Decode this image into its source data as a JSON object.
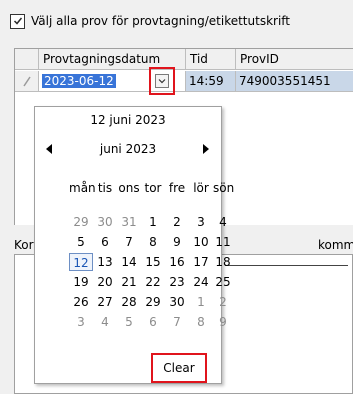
{
  "select_all": {
    "label": "Välj alla prov för provtagning/etikettutskrift",
    "checked": true
  },
  "grid": {
    "columns": [
      "Provtagningsdatum",
      "Tid",
      "ProvID"
    ],
    "row": {
      "date": "2023-06-12",
      "time": "14:59",
      "prov_id": "749003551451"
    }
  },
  "lower": {
    "left_label": "Kor",
    "right_label": "komm"
  },
  "calendar": {
    "today_text": "12 juni 2023",
    "month_text": "juni 2023",
    "weekdays": [
      "mån",
      "tis",
      "ons",
      "tor",
      "fre",
      "lör",
      "sön"
    ],
    "weeks": [
      [
        "29",
        "30",
        "31",
        "1",
        "2",
        "3",
        "4"
      ],
      [
        "5",
        "6",
        "7",
        "8",
        "9",
        "10",
        "11"
      ],
      [
        "12",
        "13",
        "14",
        "15",
        "16",
        "17",
        "18"
      ],
      [
        "19",
        "20",
        "21",
        "22",
        "23",
        "24",
        "25"
      ],
      [
        "26",
        "27",
        "28",
        "29",
        "30",
        "1",
        "2"
      ],
      [
        "3",
        "4",
        "5",
        "6",
        "7",
        "8",
        "9"
      ]
    ],
    "selected_day": "12",
    "clear_label": "Clear"
  },
  "colors": {
    "highlight_red": "#e0141c",
    "selection_blue": "#3874d8",
    "row_blue": "#c9d7e8"
  },
  "icons": [
    "checkmark-icon",
    "chevron-down-icon",
    "pencil-icon",
    "arrow-left-icon",
    "arrow-right-icon"
  ]
}
